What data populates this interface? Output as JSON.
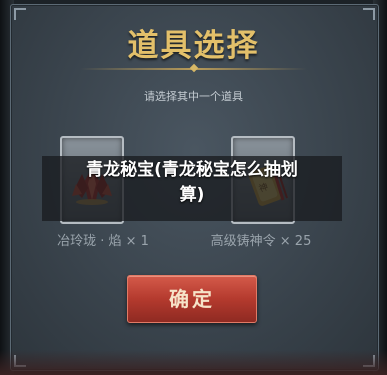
{
  "dialog": {
    "title": "道具选择",
    "subtitle": "请选择其中一个道具",
    "confirm_label": "确定"
  },
  "items": [
    {
      "name": "冶玲珑 · 焰 × 1",
      "icon": "red-crystal-icon"
    },
    {
      "name": "高级铸神令 × 25",
      "icon": "gold-token-icon"
    }
  ],
  "overlay": {
    "line1": "青龙秘宝(青龙秘宝怎么抽划",
    "line2": "算)"
  },
  "colors": {
    "title": "#e3c06a",
    "confirm": "#b43a2e",
    "panel": "#3a444d"
  }
}
